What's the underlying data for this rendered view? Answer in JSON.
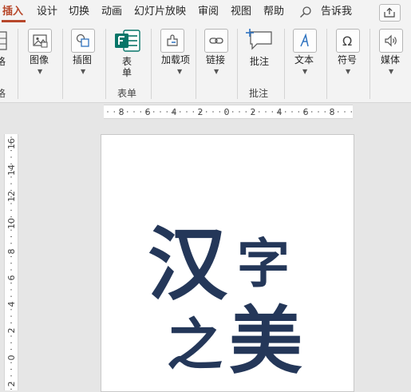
{
  "tabs": [
    "插入",
    "设计",
    "切换",
    "动画",
    "幻灯片放映",
    "审阅",
    "视图",
    "帮助"
  ],
  "active_tab": "插入",
  "tell_me": "告诉我",
  "ribbon": {
    "partial_left_label": "格",
    "partial_left_group": "格",
    "image": "图像",
    "illustration": "插图",
    "form": "表单",
    "form_group": "表单",
    "addins": "加载项",
    "link": "链接",
    "comment": "批注",
    "comment_group": "批注",
    "text": "文本",
    "symbol": "符号",
    "media": "媒体"
  },
  "ruler_h": [
    "8",
    "6",
    "4",
    "2",
    "0",
    "2",
    "4",
    "6",
    "8"
  ],
  "ruler_v": [
    "16",
    "14",
    "12",
    "10",
    "8",
    "6",
    "4",
    "2",
    "0",
    "2"
  ],
  "slide_text": {
    "c1": "汉",
    "c2": "字",
    "c3": "之",
    "c4": "美"
  },
  "colors": {
    "accent": "#b7472a",
    "forms_green": "#077568",
    "text_navy": "#243759",
    "ribbon_bg": "#f3f3f3"
  }
}
